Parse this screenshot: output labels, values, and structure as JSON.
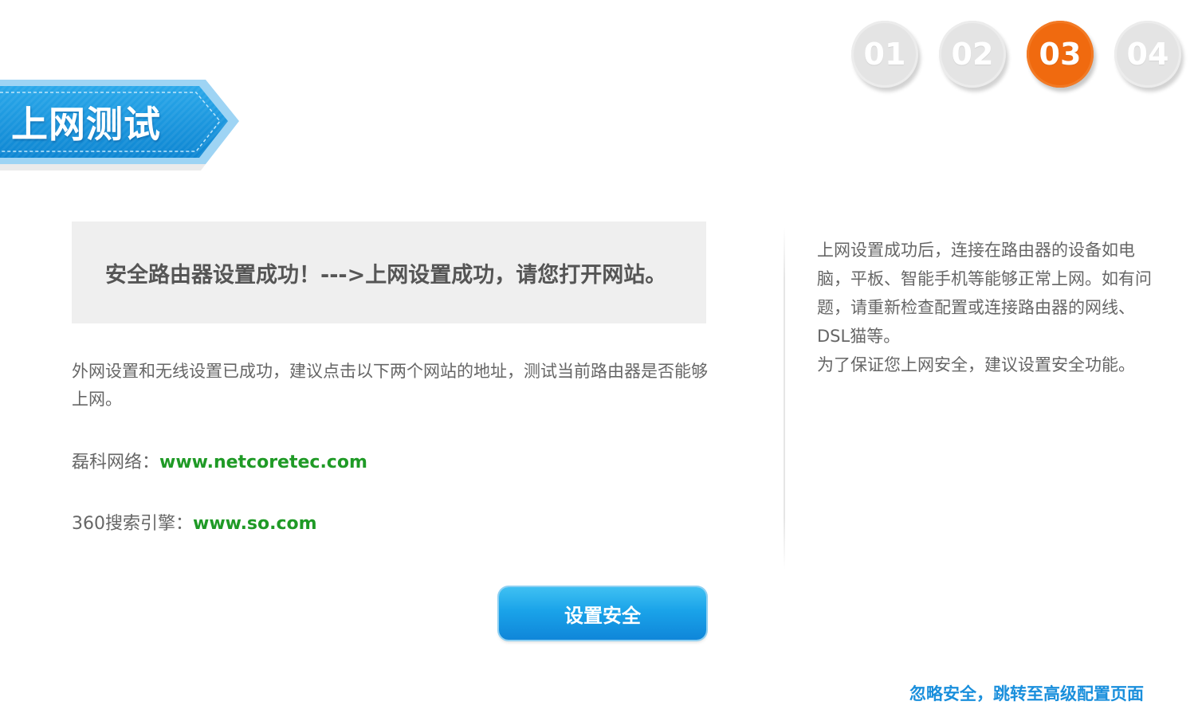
{
  "steps": [
    {
      "label": "01",
      "state": "inactive"
    },
    {
      "label": "02",
      "state": "inactive"
    },
    {
      "label": "03",
      "state": "active"
    },
    {
      "label": "04",
      "state": "inactive"
    }
  ],
  "banner": {
    "title": "上网测试"
  },
  "main": {
    "message": "安全路由器设置成功！--->上网设置成功，请您打开网站。",
    "description": "外网设置和无线设置已成功，建议点击以下两个网站的地址，测试当前路由器是否能够上网。",
    "sites": [
      {
        "label": "磊科网络：",
        "url": "www.netcoretec.com"
      },
      {
        "label": "360搜索引擎：",
        "url": "www.so.com"
      }
    ],
    "setup_button": "设置安全"
  },
  "side": {
    "paragraph1": "上网设置成功后，连接在路由器的设备如电脑，平板、智能手机等能够正常上网。如有问题，请重新检查配置或连接路由器的网线、DSL猫等。",
    "paragraph2": "为了保证您上网安全，建议设置安全功能。"
  },
  "footer": {
    "skip_link": "忽略安全，跳转至高级配置页面"
  },
  "colors": {
    "accent_orange": "#f06a0f",
    "accent_blue": "#1aa3e9",
    "link_green": "#1f9a26",
    "link_blue": "#1a8fdc"
  }
}
